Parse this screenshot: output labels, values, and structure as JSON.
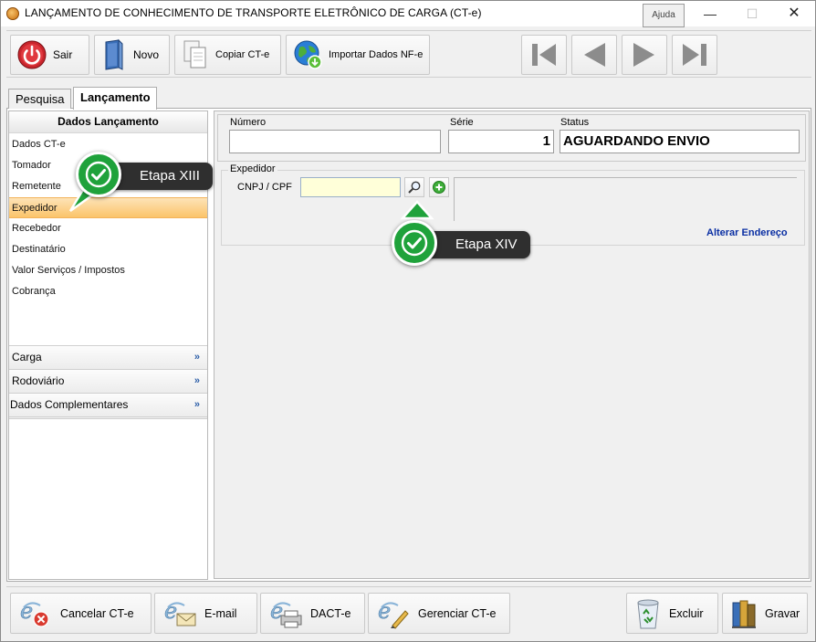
{
  "window": {
    "title": "LANÇAMENTO DE CONHECIMENTO DE TRANSPORTE ELETRÔNICO DE CARGA (CT-e)",
    "help_tooltip": "Ajuda",
    "minimize_glyph": "—",
    "maximize_glyph": "☐",
    "close_glyph": "✕"
  },
  "toolbar": {
    "sair": "Sair",
    "novo": "Novo",
    "copiar": "Copiar CT-e",
    "importar": "Importar Dados NF-e"
  },
  "tabs": {
    "pesquisa": "Pesquisa",
    "lancamento": "Lançamento"
  },
  "left_panel": {
    "header": "Dados Lançamento",
    "items": [
      {
        "label": "Dados CT-e"
      },
      {
        "label": "Tomador"
      },
      {
        "label": "Remetente"
      },
      {
        "label": "Expedidor",
        "selected": true
      },
      {
        "label": "Recebedor"
      },
      {
        "label": "Destinatário"
      },
      {
        "label": "Valor Serviços / Impostos"
      },
      {
        "label": "Cobrança"
      }
    ],
    "sections": [
      {
        "label": "Carga"
      },
      {
        "label": "Rodoviário"
      },
      {
        "label": "Dados Complementares"
      }
    ],
    "chevron": "»"
  },
  "header_fields": {
    "numero_label": "Número",
    "numero_value": "",
    "serie_label": "Série",
    "serie_value": "1",
    "status_label": "Status",
    "status_value": "AGUARDANDO ENVIO"
  },
  "expedidor": {
    "legend": "Expedidor",
    "cnpj_label": "CNPJ / CPF",
    "cnpj_value": "",
    "alterar_endereco": "Alterar Endereço"
  },
  "callouts": {
    "step13": "Etapa XIII",
    "step14": "Etapa XIV",
    "color": "#1fa23b"
  },
  "bottom_bar": {
    "cancelar": "Cancelar CT-e",
    "email": "E-mail",
    "dacte": "DACT-e",
    "gerenciar": "Gerenciar CT-e",
    "excluir": "Excluir",
    "gravar": "Gravar"
  }
}
